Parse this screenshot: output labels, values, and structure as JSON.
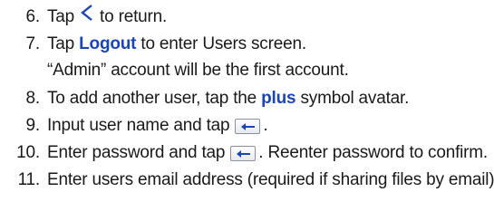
{
  "steps": [
    {
      "num": "6.",
      "pre": "Tap",
      "icon": "chevron-left-icon",
      "post": "to return."
    },
    {
      "num": "7.",
      "pre": "Tap",
      "bold": "Logout",
      "post": "to enter Users screen."
    },
    {
      "num": "",
      "text": "“Admin” account will be the first account."
    },
    {
      "num": "8.",
      "pre": "To add another user, tap the",
      "bold": "plus",
      "post": "symbol avatar."
    },
    {
      "num": "9.",
      "pre": "Input user name and tap",
      "icon": "enter-key-icon",
      "post": "."
    },
    {
      "num": "10.",
      "pre": "Enter password and tap",
      "icon": "enter-key-icon",
      "post": ". Reenter password to confirm."
    },
    {
      "num": "11.",
      "text": "Enter users email address (required if sharing files by email)."
    }
  ],
  "colors": {
    "text": "#1a1a1a",
    "accent": "#1a44b8"
  }
}
